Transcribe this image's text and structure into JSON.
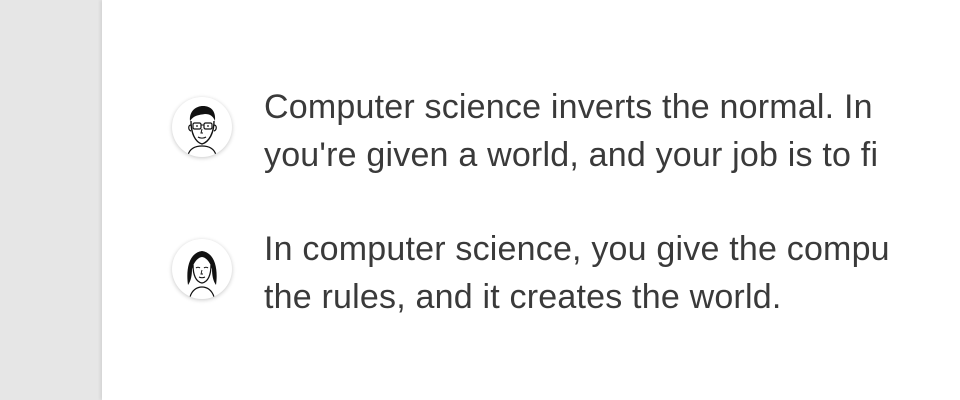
{
  "conversation": {
    "messages": [
      {
        "avatar_icon": "man-with-glasses-avatar-icon",
        "lines": [
          "Computer science inverts the normal. In",
          "you're given a world, and your job is to fi"
        ]
      },
      {
        "avatar_icon": "woman-avatar-icon",
        "lines": [
          "In computer science, you give the compu",
          "the rules, and it creates the world."
        ]
      }
    ]
  },
  "colors": {
    "background": "#e6e6e6",
    "panel": "#ffffff",
    "text": "#3a3a3a"
  }
}
